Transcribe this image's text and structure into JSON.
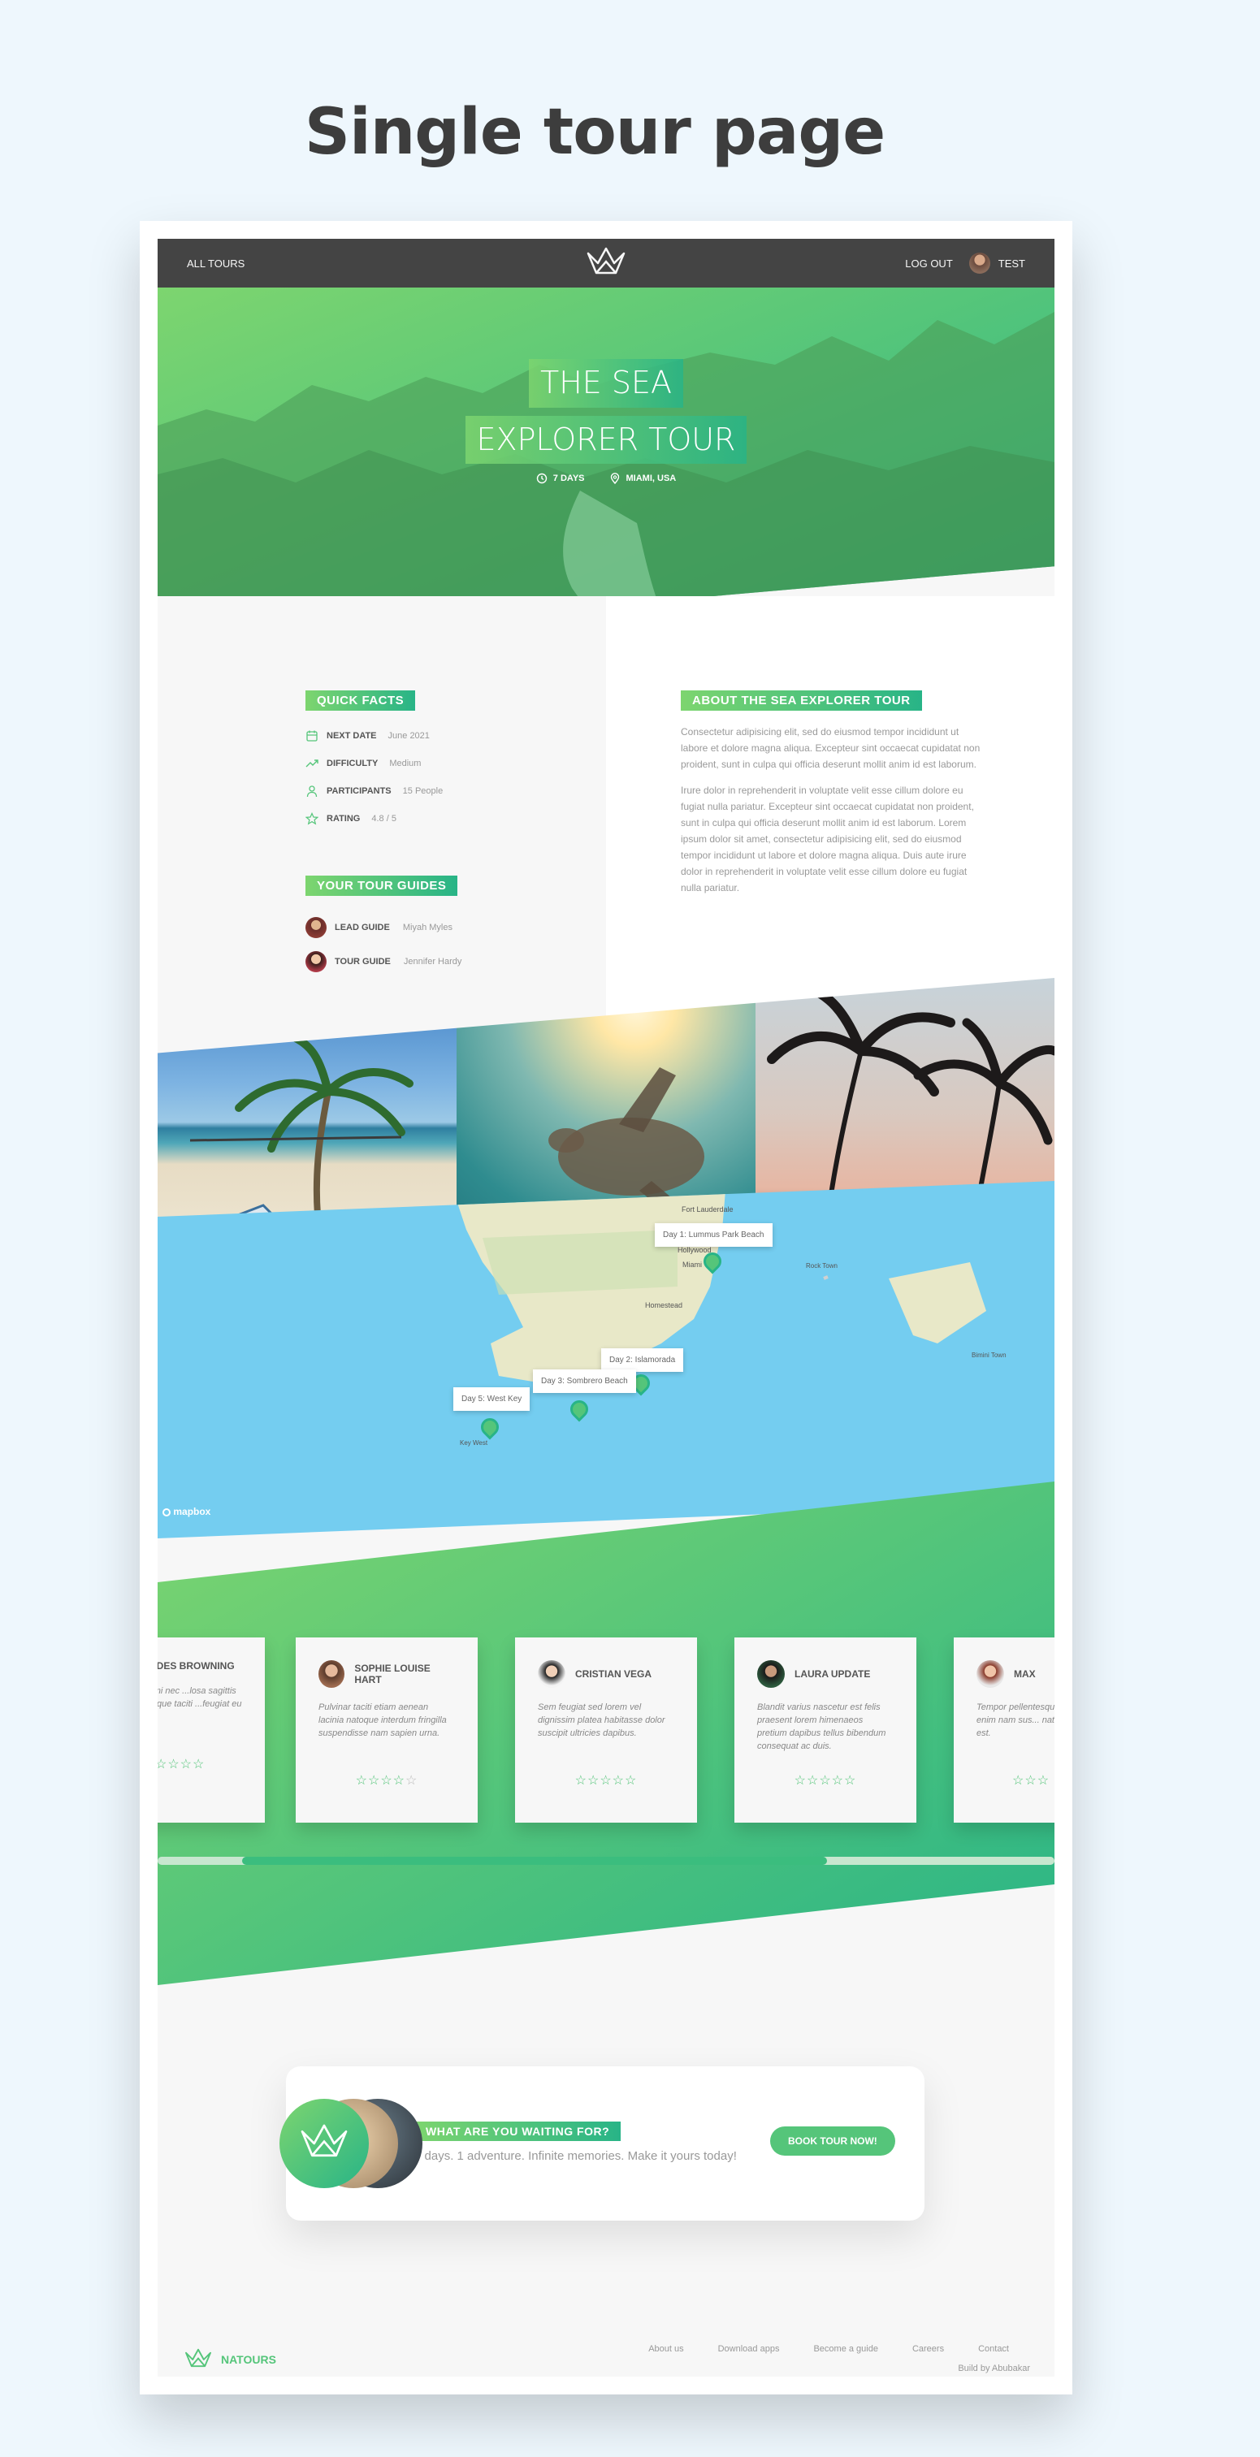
{
  "page_heading": "Single tour page",
  "header": {
    "nav_all_tours": "All tours",
    "logout": "Log out",
    "user_name": "Test"
  },
  "hero": {
    "title_line1": "The Sea",
    "title_line2": "Explorer Tour",
    "duration": "7 days",
    "location": "Miami, USA"
  },
  "quick_facts": {
    "heading": "Quick facts",
    "items": [
      {
        "label": "Next date",
        "value": "June 2021",
        "icon": "calendar-icon"
      },
      {
        "label": "Difficulty",
        "value": "Medium",
        "icon": "trending-up-icon"
      },
      {
        "label": "Participants",
        "value": "15 People",
        "icon": "user-icon"
      },
      {
        "label": "Rating",
        "value": "4.8 / 5",
        "icon": "star-icon"
      }
    ]
  },
  "tour_guides": {
    "heading": "Your tour guides",
    "items": [
      {
        "role": "Lead guide",
        "name": "Miyah Myles"
      },
      {
        "role": "Tour guide",
        "name": "Jennifer Hardy"
      }
    ]
  },
  "about": {
    "heading": "About the sea explorer tour",
    "paragraph1": "Consectetur adipisicing elit, sed do eiusmod tempor incididunt ut labore et dolore magna aliqua. Excepteur sint occaecat cupidatat non proident, sunt in culpa qui officia deserunt mollit anim id est laborum.",
    "paragraph2": "Irure dolor in reprehenderit in voluptate velit esse cillum dolore eu fugiat nulla pariatur. Excepteur sint occaecat cupidatat non proident, sunt in culpa qui officia deserunt mollit anim id est laborum. Lorem ipsum dolor sit amet, consectetur adipisicing elit, sed do eiusmod tempor incididunt ut labore et dolore magna aliqua. Duis aute irure dolor in reprehenderit in voluptate velit esse cillum dolore eu fugiat nulla pariatur."
  },
  "map": {
    "attribution": "mapbox",
    "locations": [
      {
        "label": "Day 1: Lummus Park Beach"
      },
      {
        "label": "Day 2: Islamorada"
      },
      {
        "label": "Day 3: Sombrero Beach"
      },
      {
        "label": "Day 5: West Key"
      }
    ],
    "place_names": [
      "Fort Lauderdale",
      "Hollywood",
      "Miami",
      "Homestead",
      "Key West",
      "Rock Town",
      "Bimini Town"
    ]
  },
  "reviews": [
    {
      "name": "ERDES BROWNING",
      "text": "...perturient mi nec ...losa sagittis eros ...lentesque taciti ...feugiat eu nascetur a.",
      "rating": 5
    },
    {
      "name": "SOPHIE LOUISE HART",
      "text": "Pulvinar taciti etiam aenean lacinia natoque interdum fringilla suspendisse nam sapien urna.",
      "rating": 4
    },
    {
      "name": "CRISTIAN VEGA",
      "text": "Sem feugiat sed lorem vel dignissim platea habitasse dolor suscipit ultricies dapibus.",
      "rating": 5
    },
    {
      "name": "LAURA UPDATE",
      "text": "Blandit varius nascetur est felis praesent lorem himenaeos pretium dapibus tellus bibendum consequat ac duis.",
      "rating": 5
    },
    {
      "name": "MAX",
      "text": "Tempor pellentesque ...auctor enim nam sus... natoque ipsum est.",
      "rating": 5
    }
  ],
  "cta": {
    "heading": "What are you waiting for?",
    "text": "7 days. 1 adventure. Infinite memories. Make it yours today!",
    "button": "Book tour now!"
  },
  "footer": {
    "brand": "Natours",
    "links": [
      "About us",
      "Download apps",
      "Become a guide",
      "Careers",
      "Contact"
    ],
    "copyright": "Build by Abubakar"
  },
  "colors": {
    "green_light": "#7dd56f",
    "green_dark": "#28b487",
    "green_primary": "#55c57a",
    "header_bg": "#444444",
    "map_water": "#74cdf0"
  }
}
